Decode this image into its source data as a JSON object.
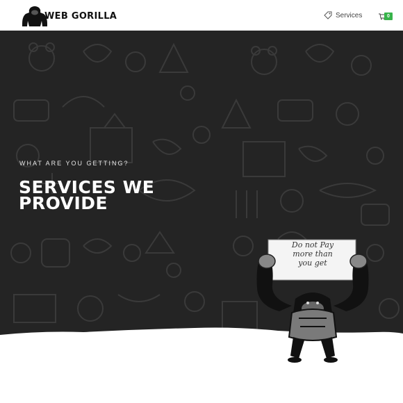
{
  "header": {
    "brand": "WEB GORILLA",
    "nav_services_label": "Services",
    "cart_count": "0"
  },
  "hero": {
    "eyebrow": "WHAT ARE YOU GETTING?",
    "title": "SERVICES WE\nPROVIDE",
    "sign_text": [
      "Do not Pay",
      "more than",
      "you get"
    ]
  },
  "colors": {
    "hero_background": "#242424",
    "cart_badge": "#37b34a",
    "text_dark": "#111111"
  },
  "icons": [
    "gorilla-logo-icon",
    "tag-icon",
    "cart-icon"
  ]
}
